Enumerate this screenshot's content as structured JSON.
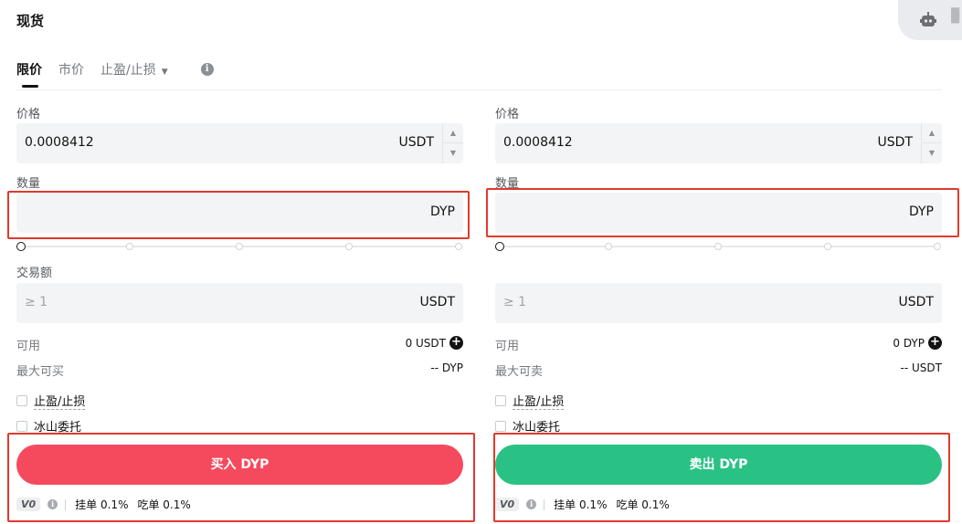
{
  "title": "现货",
  "tabs": [
    {
      "label": "限价",
      "active": true
    },
    {
      "label": "市价",
      "active": false
    },
    {
      "label": "止盈/止损",
      "active": false,
      "has_dropdown": true
    }
  ],
  "buy": {
    "price_label": "价格",
    "price_value": "0.0008412",
    "price_unit": "USDT",
    "amount_label": "数量",
    "amount_unit": "DYP",
    "total_label": "交易额",
    "total_placeholder": "≥ 1",
    "total_unit": "USDT",
    "available_label": "可用",
    "available_value": "0 USDT",
    "max_label": "最大可买",
    "max_value": "-- DYP",
    "tpsl_label": "止盈/止损",
    "iceberg_label": "冰山委托",
    "button_label": "买入 DYP",
    "vip_label": "V0",
    "maker_fee": "挂单 0.1%",
    "taker_fee": "吃单 0.1%"
  },
  "sell": {
    "price_label": "价格",
    "price_value": "0.0008412",
    "price_unit": "USDT",
    "amount_label": "数量",
    "amount_unit": "DYP",
    "total_placeholder": "≥ 1",
    "total_unit": "USDT",
    "available_label": "可用",
    "available_value": "0 DYP",
    "max_label": "最大可卖",
    "max_value": "-- USDT",
    "tpsl_label": "止盈/止损",
    "iceberg_label": "冰山委托",
    "button_label": "卖出 DYP",
    "vip_label": "V0",
    "maker_fee": "挂单 0.1%",
    "taker_fee": "吃单 0.1%"
  },
  "slider": {
    "steps": 5,
    "value_percent": 0
  },
  "colors": {
    "buy": "#f54a5d",
    "sell": "#2ac185",
    "highlight_box": "#e03a2f"
  },
  "icons": {
    "robot": "robot-icon",
    "drag": "drag-handle-icon",
    "info": "info-icon",
    "add": "plus-circle-icon"
  }
}
